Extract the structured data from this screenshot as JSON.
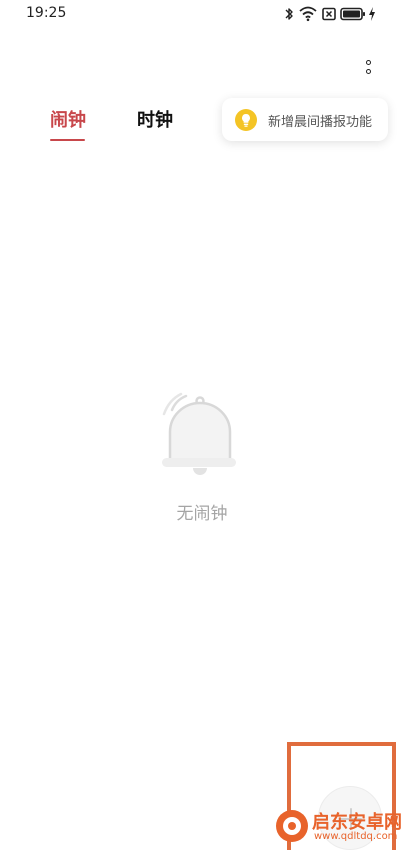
{
  "status_bar": {
    "time": "19:25",
    "icons": [
      "bluetooth-icon",
      "wifi-icon",
      "notification-icon",
      "battery-icon",
      "charging-icon"
    ]
  },
  "menu": {
    "icon": "more-vertical-icon"
  },
  "tabs": [
    {
      "label": "闹钟",
      "active": true
    },
    {
      "label": "时钟",
      "active": false
    }
  ],
  "tip": {
    "icon": "lightbulb-icon",
    "text": "新增晨间播报功能"
  },
  "empty_state": {
    "icon": "bell-icon",
    "text": "无闹钟"
  },
  "add_button": {
    "icon": "plus-icon"
  },
  "watermark": {
    "title": "启东安卓网",
    "url": "www.qdltdq.com"
  },
  "colors": {
    "accent": "#c8474b",
    "tip_icon": "#f4c425",
    "highlight": "#e06c3d",
    "watermark": "#e8632b",
    "muted_text": "#a5a5a5"
  }
}
